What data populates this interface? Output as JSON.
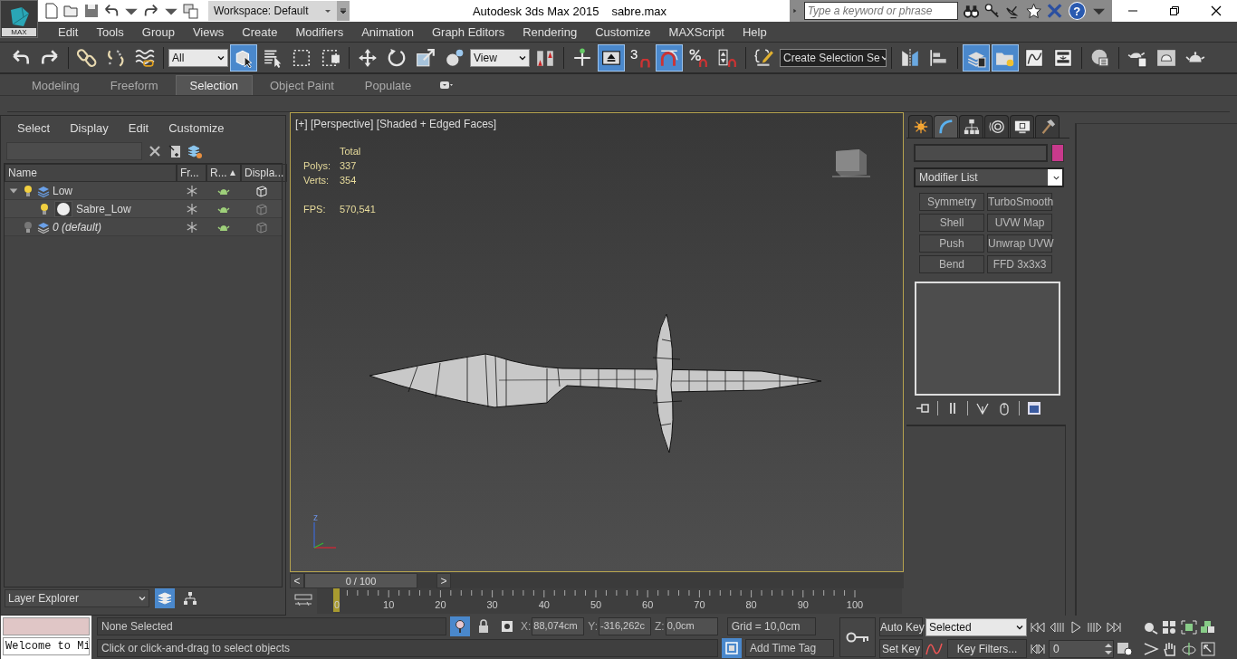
{
  "title_bar": {
    "logo_label": "MAX",
    "workspace": "Workspace: Default",
    "title": "Autodesk 3ds Max  2015",
    "file": "sabre.max",
    "search": {
      "placeholder": "Type a keyword or phrase"
    },
    "help": "?"
  },
  "menu": [
    "Edit",
    "Tools",
    "Group",
    "Views",
    "Create",
    "Modifiers",
    "Animation",
    "Graph Editors",
    "Rendering",
    "Customize",
    "MAXScript",
    "Help"
  ],
  "main_toolbar": {
    "items": [
      {
        "kind": "undo",
        "active": false
      },
      {
        "kind": "redo",
        "active": false
      },
      {
        "kind": "sep"
      },
      {
        "kind": "link",
        "active": false
      },
      {
        "kind": "unlink",
        "active": false
      },
      {
        "kind": "wave",
        "active": false
      },
      {
        "kind": "sep"
      },
      {
        "kind": "dropdown",
        "value": "All"
      },
      {
        "kind": "select",
        "active": true
      },
      {
        "kind": "select_name",
        "active": false
      },
      {
        "kind": "rect",
        "active": false
      },
      {
        "kind": "crossing",
        "active": false
      },
      {
        "kind": "sep"
      },
      {
        "kind": "move",
        "active": false
      },
      {
        "kind": "rotate",
        "active": false
      },
      {
        "kind": "scale",
        "active": false
      },
      {
        "kind": "place",
        "active": false
      },
      {
        "kind": "dropdown",
        "value": "View"
      },
      {
        "kind": "pivot",
        "active": false
      },
      {
        "kind": "sep"
      },
      {
        "kind": "manipulate",
        "active": false
      },
      {
        "kind": "keyboard",
        "active": true
      },
      {
        "kind": "snap",
        "label": "3",
        "active": false
      },
      {
        "kind": "angle",
        "active": true
      },
      {
        "kind": "percent",
        "active": false
      },
      {
        "kind": "spinner",
        "active": false
      },
      {
        "kind": "sep"
      },
      {
        "kind": "named_sel",
        "active": false
      },
      {
        "kind": "dropdown",
        "value": "Create Selection Se"
      },
      {
        "kind": "sep"
      },
      {
        "kind": "mirror",
        "active": false
      },
      {
        "kind": "align",
        "active": false
      },
      {
        "kind": "sep"
      },
      {
        "kind": "layers",
        "active": true
      },
      {
        "kind": "explorer",
        "active": true
      },
      {
        "kind": "curve",
        "active": false
      },
      {
        "kind": "schematic",
        "active": false
      },
      {
        "kind": "sep"
      },
      {
        "kind": "material",
        "active": false
      },
      {
        "kind": "sep"
      },
      {
        "kind": "render_setup",
        "active": false
      },
      {
        "kind": "frame_window",
        "active": false
      },
      {
        "kind": "render",
        "active": false
      }
    ]
  },
  "ribbon": {
    "tabs": [
      {
        "label": "Modeling",
        "selected": false
      },
      {
        "label": "Freeform",
        "selected": false
      },
      {
        "label": "Selection",
        "selected": true
      },
      {
        "label": "Object Paint",
        "selected": false
      },
      {
        "label": "Populate",
        "selected": false
      }
    ]
  },
  "scene_explorer": {
    "menu": [
      "Select",
      "Display",
      "Edit",
      "Customize"
    ],
    "columns": [
      {
        "label": "Name",
        "sorted": false
      },
      {
        "label": "Fr...",
        "sorted": false
      },
      {
        "label": "R...",
        "sorted": true
      },
      {
        "label": "Displa...",
        "sorted": false
      }
    ],
    "rows": [
      {
        "name": "Low",
        "kind": "layer",
        "hidden": false,
        "expanded": true,
        "children": [
          {
            "name": "Sabre_Low",
            "kind": "object",
            "hidden": false
          }
        ]
      },
      {
        "name": "0 (default)",
        "kind": "layer",
        "hidden": true
      }
    ],
    "mode": "Layer Explorer"
  },
  "viewport": {
    "label": "[+] [Perspective] [Shaded + Edged Faces]",
    "stats_header": "Total",
    "stats": [
      {
        "label": "Polys:",
        "value": "337"
      },
      {
        "label": "Verts:",
        "value": "354"
      }
    ],
    "fps_label": "FPS:",
    "fps": "570,541",
    "axis_label": "z"
  },
  "time_slider": {
    "prev": "<",
    "readout": "0 / 100",
    "next": ">",
    "level": 0
  },
  "track": {
    "labels": [
      "0",
      "10",
      "20",
      "30",
      "40",
      "50",
      "60",
      "70",
      "80",
      "90",
      "100"
    ]
  },
  "command_panel": {
    "tabs": [
      {
        "kind": "create",
        "selected": false
      },
      {
        "kind": "modify",
        "selected": true
      },
      {
        "kind": "hierarchy",
        "selected": false
      },
      {
        "kind": "motion",
        "selected": false
      },
      {
        "kind": "display",
        "selected": false
      },
      {
        "kind": "utilities",
        "selected": false
      }
    ],
    "modifier_list": "Modifier List",
    "modifier_buttons": [
      "Symmetry",
      "TurboSmooth",
      "Shell",
      "UVW Map",
      "Push",
      "Unwrap UVW",
      "Bend",
      "FFD 3x3x3"
    ]
  },
  "status": {
    "listener_output": "Welcome to Mi",
    "selection": "None Selected",
    "isolate_on": true,
    "coords": [
      {
        "axis": "X:",
        "value": "88,074cm"
      },
      {
        "axis": "Y:",
        "value": "-316,262c"
      },
      {
        "axis": "Z:",
        "value": "0,0cm"
      }
    ],
    "grid": "Grid = 10,0cm",
    "prompt": "Click or click-and-drag to select objects",
    "time_tag": "Add Time Tag",
    "auto_key": "Auto Key",
    "set_key": "Set Key",
    "key_mode": "Selected",
    "key_filters": "Key Filters...",
    "frame": "0"
  }
}
